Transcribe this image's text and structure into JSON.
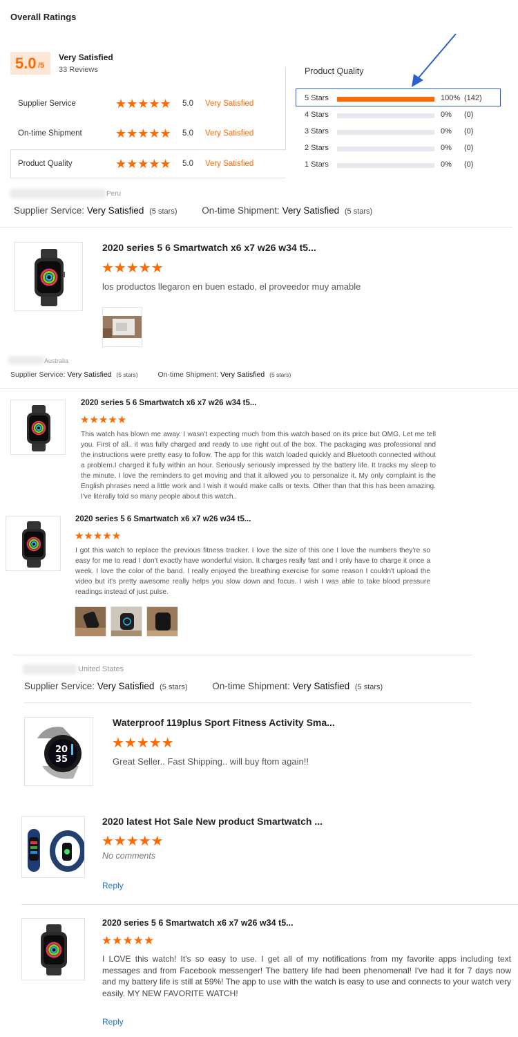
{
  "overall": {
    "heading": "Overall Ratings",
    "score": "5.0",
    "score_suffix": "/5",
    "satisfaction": "Very Satisfied",
    "reviews": "33 Reviews",
    "criteria": [
      {
        "label": "Supplier Service",
        "score": "5.0",
        "text": "Very Satisfied",
        "rating": 5
      },
      {
        "label": "On-time Shipment",
        "score": "5.0",
        "text": "Very Satisfied",
        "rating": 5
      },
      {
        "label": "Product Quality",
        "score": "5.0",
        "text": "Very Satisfied",
        "rating": 5
      }
    ]
  },
  "product_quality": {
    "heading": "Product Quality",
    "rows": [
      {
        "label": "5 Stars",
        "percent": "100%",
        "count": "(142)",
        "fill": 1.0
      },
      {
        "label": "4 Stars",
        "percent": "0%",
        "count": "(0)",
        "fill": 0
      },
      {
        "label": "3 Stars",
        "percent": "0%",
        "count": "(0)",
        "fill": 0
      },
      {
        "label": "2 Stars",
        "percent": "0%",
        "count": "(0)",
        "fill": 0
      },
      {
        "label": "1 Stars",
        "percent": "0%",
        "count": "(0)",
        "fill": 0
      }
    ]
  },
  "buyer1": {
    "country": "Peru",
    "supplier_label": "Supplier Service:",
    "supplier_value": "Very Satisfied",
    "supplier_stars": "(5 stars)",
    "shipment_label": "On-time Shipment:",
    "shipment_value": "Very Satisfied",
    "shipment_stars": "(5 stars)",
    "review": {
      "title": "2020 series 5 6 Smartwatch x6 x7 w26 w34 t5...",
      "rating": 5,
      "text": "los productos llegaron en buen estado, el proveedor muy amable"
    }
  },
  "buyer2": {
    "country": "Australia",
    "supplier_label": "Supplier Service:",
    "supplier_value": "Very Satisfied",
    "supplier_stars": "(5 stars)",
    "shipment_label": "On-time Shipment:",
    "shipment_value": "Very Satisfied",
    "shipment_stars": "(5 stars)",
    "reviews": [
      {
        "title": "2020 series 5 6 Smartwatch x6 x7 w26 w34 t5...",
        "rating": 5,
        "text": "This watch has blown me away. I wasn't expecting much from this watch based on its price but OMG. Let me tell you. First of all.. it was fully charged and ready to use right out of the box. The packaging was professional and the instructions were pretty easy to follow. The app for this watch loaded quickly and Bluetooth connected without a problem.I charged it fully within an hour. Seriously seriously impressed by the battery life. It tracks my sleep to the minute. I love the reminders to get moving and that it allowed you to personalize it. My only complaint is the English phrases need a little work and I wish it would make calls or texts. Other than that this has been amazing. I've literally told so many people about this watch.."
      },
      {
        "title": "2020 series 5 6 Smartwatch x6 x7 w26 w34 t5...",
        "rating": 5,
        "text": "I got this watch to replace the previous fitness tracker. I love the size of this one I love the numbers they're so easy for me to read I don't exactly have wonderful vision. It charges really fast and I only have to charge it once a week. I love the color of the band. I really enjoyed the breathing exercise for some reason I couldn't upload the video but it's pretty awesome really helps you slow down and focus. I wish I was able to take blood pressure readings instead of just pulse."
      }
    ]
  },
  "buyer3": {
    "country": "United States",
    "supplier_label": "Supplier Service:",
    "supplier_value": "Very Satisfied",
    "supplier_stars": "(5 stars)",
    "shipment_label": "On-time Shipment:",
    "shipment_value": "Very Satisfied",
    "shipment_stars": "(5 stars)",
    "reviews": [
      {
        "title": "Waterproof 119plus Sport Fitness Activity Sma...",
        "rating": 5,
        "text": "Great Seller.. Fast Shipping.. will buy ftom again!!"
      },
      {
        "title": "2020 latest Hot Sale New product Smartwatch ...",
        "rating": 5,
        "text": "No comments",
        "reply": "Reply"
      },
      {
        "title": "2020 series 5 6 Smartwatch x6 x7 w26 w34 t5...",
        "rating": 5,
        "text": "I LOVE this watch! It's so easy to use. I get all of my notifications from my favorite apps including text messages and from Facebook messenger! The battery life had been phenomenal! I've had it for 7 days now and my battery life is still at 59%! The app to use with the watch is easy to use and connects to your watch very easily. MY NEW FAVORITE WATCH!",
        "reply": "Reply"
      }
    ]
  },
  "watch_face_numbers": [
    "20",
    "35"
  ],
  "colors": {
    "accent": "#ff6a00",
    "highlight_box": "#1f5fc7",
    "arrow": "#2a5fd0",
    "score_bg": "#fde8d8"
  }
}
